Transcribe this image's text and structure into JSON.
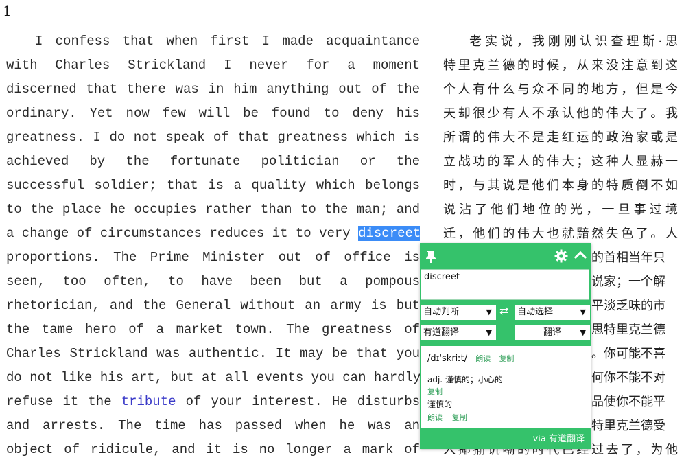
{
  "chapter_number": "1",
  "english_lines": [
    "I confess that when first I made acquaintance",
    "with Charles Strickland I never for a moment",
    "discerned that there was in him anything out of the",
    "ordinary. Yet now few will be found to deny his",
    "greatness. I do not speak of that greatness which is",
    "achieved by the fortunate politician or the",
    "successful soldier; that is a quality which belongs",
    "to the place he occupies rather than to the man; and",
    "a change of circumstances reduces it to very",
    "proportions. The Prime Minister out of office is",
    "seen, too often, to have been but a pompous",
    "rhetorician, and the General without an army is but",
    "the tame hero of a market town. The greatness of",
    "Charles Strickland was authentic. It may be that you",
    "do not like his art, but at all events you can hardly",
    "refuse it the",
    "of your interest. He disturbs",
    "and arrests. The time has passed when he was an",
    "object of ridicule, and it is no longer a mark of"
  ],
  "highlighted_word": "discreet",
  "linked_word": "tribute",
  "chinese_lines": [
    "老实说，我刚刚认识查理斯·思",
    "特里克兰德的时候，从来没注意到这",
    "个人有什么与众不同的地方，但是今",
    "天却很少有人不承认他的伟大了。我",
    "所谓的伟大不是走红运的政治家或是",
    "立战功的军人的伟大；这种人显赫一",
    "时，与其说是他们本身的特质倒不如",
    "说沾了他们地位的光，一旦事过境",
    "迁，他们的伟大也就黯然失色了。人",
    "的首相当年只",
    "说家；一个解",
    "平淡乏味的市",
    "思特里克兰德",
    "。你可能不喜",
    "何你不能不对",
    "品使你不能平",
    "特里克兰德受",
    "入揶揄讥嘲的时代已经过去了，为他"
  ],
  "popup": {
    "input_text": "discreet",
    "source_lang": "自动判断",
    "target_lang": "自动选择",
    "engine": "有道翻译",
    "translate_button": "翻译",
    "swap_symbol": "⇄",
    "phonetic": "/dɪ'skriːt/",
    "read_label": "朗读",
    "copy_label": "复制",
    "definition_1": "adj. 谨慎的；小心的",
    "definition_2": "谨慎的",
    "footer": "via 有道翻译",
    "accent_color": "#35c26b"
  }
}
